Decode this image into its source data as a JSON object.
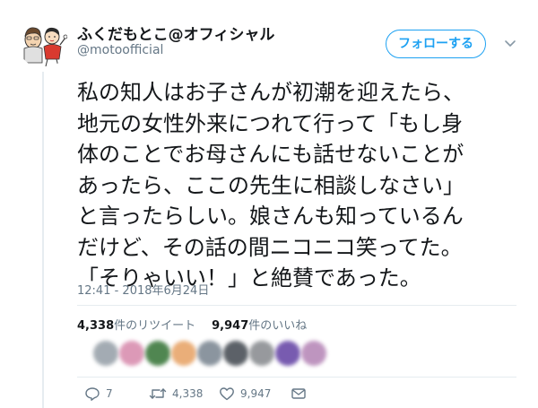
{
  "user": {
    "display_name": "ふくだもとこ@オフィシャル",
    "handle": "@motoofficial"
  },
  "follow_button": {
    "label": "フォローする"
  },
  "tweet": {
    "lines": [
      "私の知人はお子さんが初潮を迎えたら、",
      "地元の女性外来につれて行って「もし身",
      "体のことでお母さんにも話せないことが",
      "あったら、ここの先生に相談しなさい」",
      "と言ったらしい。娘さんも知っているん",
      "だけど、その話の間ニコニコ笑ってた。",
      "「そりゃいい！」と絶賛であった。"
    ],
    "timestamp": "12:41 - 2018年6月24日"
  },
  "stats": {
    "retweet_count": "4,338",
    "retweet_label": "件のリツイート",
    "like_count": "9,947",
    "like_label": "件のいいね"
  },
  "liker_avatars": [
    "#9aa3ab",
    "#d98fb0",
    "#3e7a3f",
    "#e8a66b",
    "#7f8a95",
    "#4b5158",
    "#8c8f93",
    "#6a4aa8",
    "#b88ab9",
    "#6e93c9"
  ],
  "actions": {
    "reply_count": "7",
    "retweet_count": "4,338",
    "like_count": "9,947"
  },
  "icons": {
    "reply": "reply-icon",
    "retweet": "retweet-icon",
    "like": "heart-icon",
    "message": "envelope-icon",
    "more": "chevron-down-icon"
  },
  "colors": {
    "accent": "#1da1f2",
    "secondary_text": "#657786",
    "primary_text": "#14171a"
  }
}
